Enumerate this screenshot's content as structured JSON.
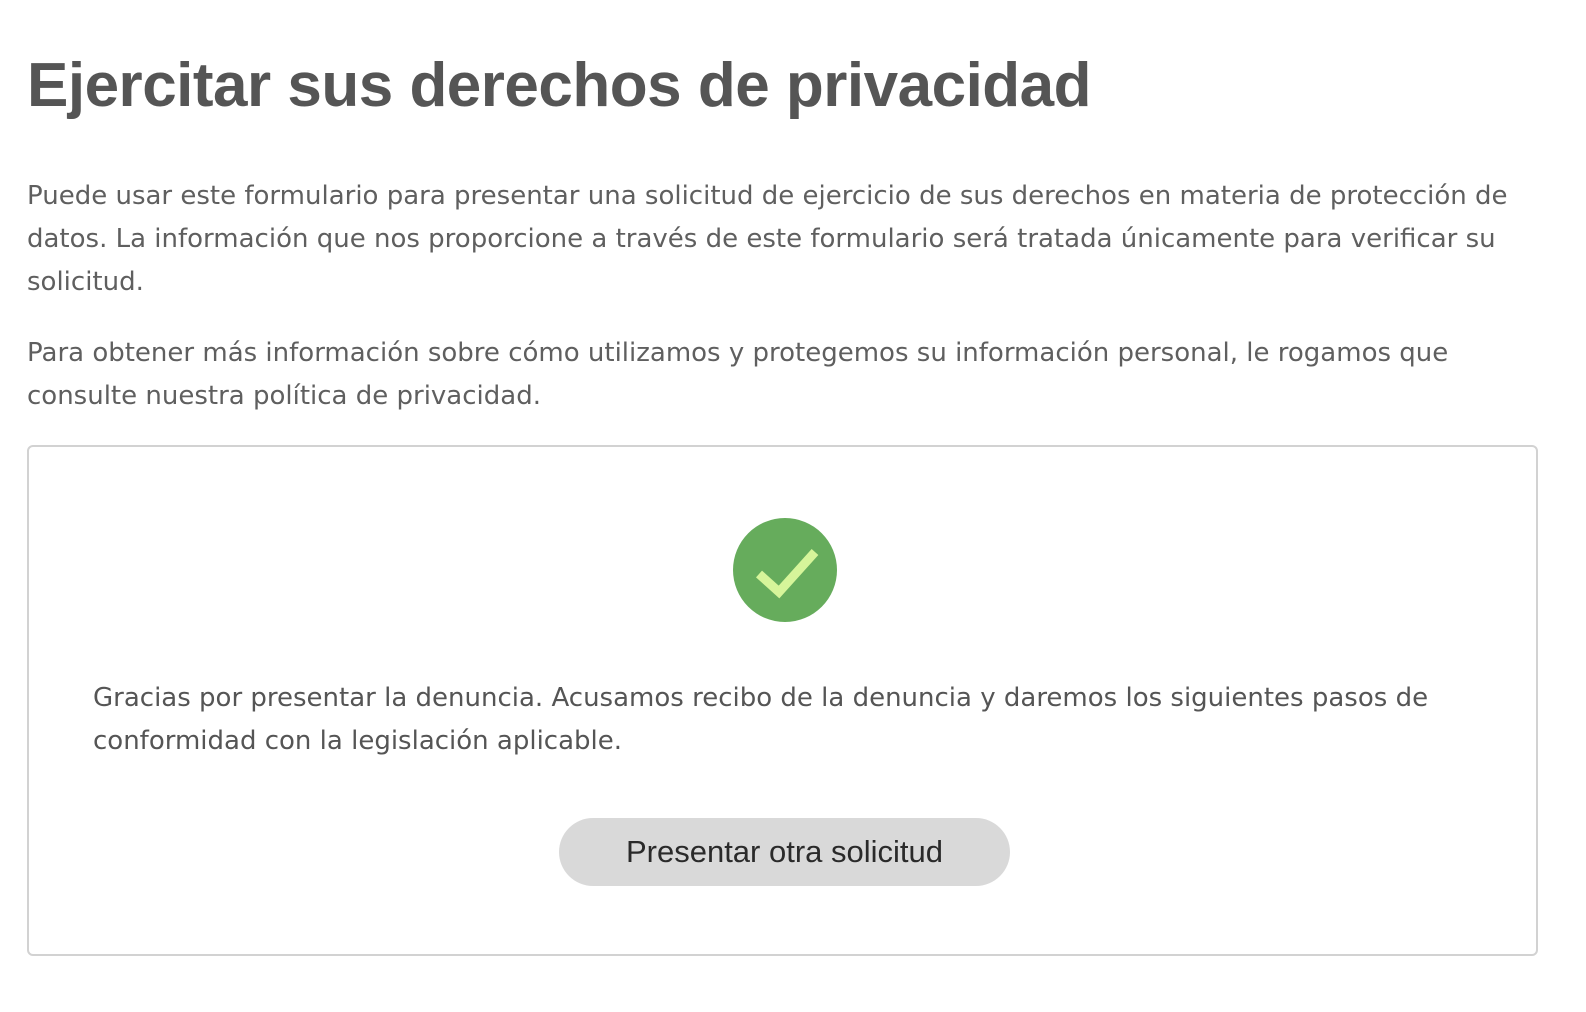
{
  "header": {
    "title": "Ejercitar sus derechos de privacidad"
  },
  "intro": {
    "paragraph_1": "Puede usar este formulario para presentar una solicitud de ejercicio de sus derechos en materia de protección de datos. La información que nos proporcione a través de este formulario será tratada únicamente para verificar su solicitud.",
    "paragraph_2": "Para obtener más información sobre cómo utilizamos y protegemos su información personal, le rogamos que consulte nuestra política de privacidad."
  },
  "confirmation": {
    "icon": "check-circle-icon",
    "icon_color": "#66ac5c",
    "check_color": "#d6f59a",
    "message": "Gracias por presentar la denuncia. Acusamos recibo de la denuncia y daremos los siguientes pasos de conformidad con la legislación aplicable.",
    "button_label": "Presentar otra solicitud"
  }
}
